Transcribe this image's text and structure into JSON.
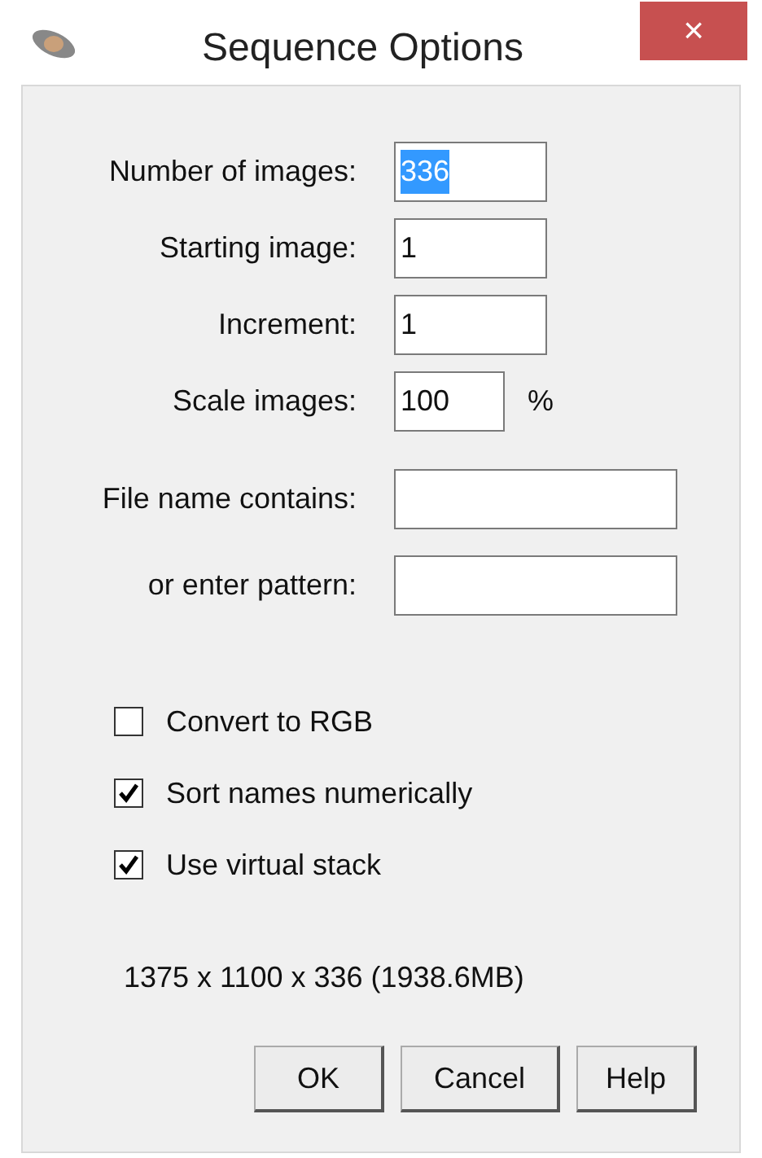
{
  "window": {
    "title": "Sequence Options",
    "close": "×"
  },
  "fields": [
    {
      "label": "Number of images:",
      "kind": "number",
      "value": "336",
      "value_selected": true
    },
    {
      "label": "Starting image:",
      "kind": "number",
      "value": "1",
      "value_selected": false
    },
    {
      "label": "Increment:",
      "kind": "number",
      "value": "1",
      "value_selected": false
    },
    {
      "label": "Scale images:",
      "kind": "number",
      "value": "100",
      "unit": "%",
      "value_selected": false
    },
    {
      "label": "File name contains:",
      "kind": "text"
    },
    {
      "label": "or enter pattern:",
      "kind": "text"
    }
  ],
  "checkboxes": [
    {
      "label": "Convert to RGB",
      "checked": false
    },
    {
      "label": "Sort names numerically",
      "checked": true
    },
    {
      "label": "Use virtual stack",
      "checked": true
    }
  ],
  "info": "1375 x 1100 x 336 (1938.6MB)",
  "buttons": [
    "OK",
    "Cancel",
    "Help"
  ]
}
